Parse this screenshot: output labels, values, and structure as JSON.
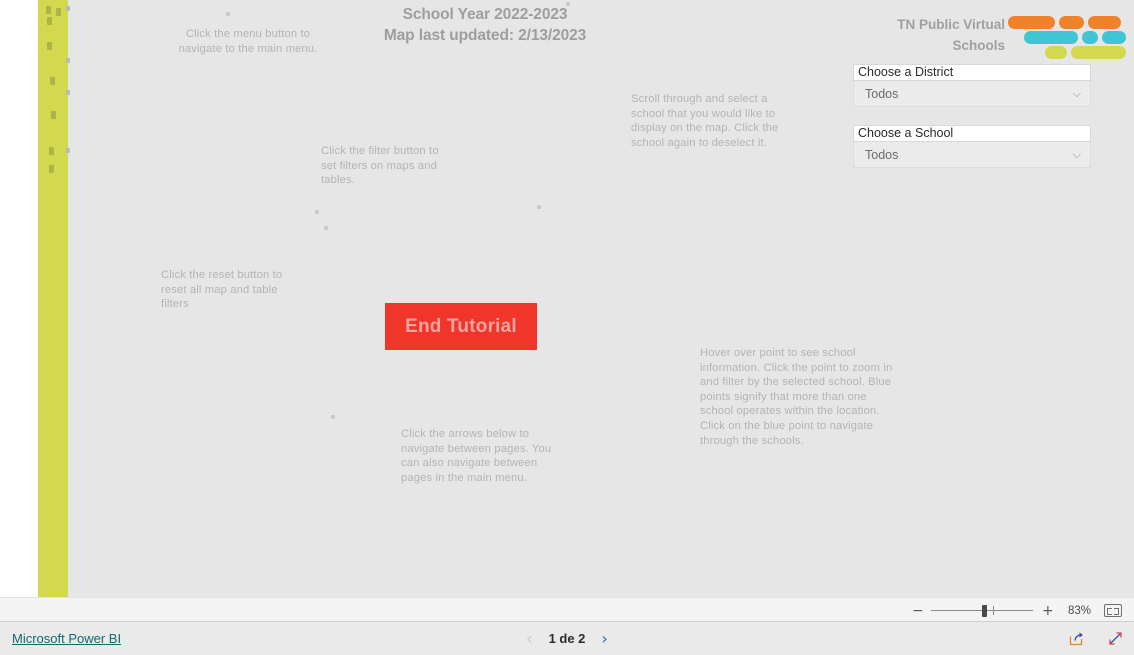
{
  "report": {
    "title_line1": "School Year 2022-2023",
    "title_line2": "Map last updated: 2/13/2023"
  },
  "brand": {
    "line1": "TN Public Virtual",
    "line2": "Schools",
    "logo_name": "tn-public-virtual-schools-logo",
    "colors": {
      "orange": "#f0832a",
      "teal": "#3fc6d4",
      "lime": "#d3d94e"
    }
  },
  "slicers": [
    {
      "header": "Choose a District",
      "value": "Todos",
      "caret": "⌵"
    },
    {
      "header": "Choose a School",
      "value": "Todos",
      "caret": "⌵"
    }
  ],
  "tutorial": {
    "annotations": [
      {
        "name": "menu-hint",
        "text": "Click the menu button to navigate to the main menu."
      },
      {
        "name": "filter-hint",
        "text": "Click the filter button to set filters on maps and tables."
      },
      {
        "name": "reset-hint",
        "text": "Click the reset button to reset all map and table filters"
      },
      {
        "name": "scroll-hint",
        "text": "Scroll through and select a school that you would like to display on the map. Click the school again to deselect it."
      },
      {
        "name": "point-hint",
        "text": "Hover over point to see school information. Click the point to zoom in and filter by the selected school. Blue points signify that more than one school operates within the location. Click on the blue point to navigate through the schools."
      },
      {
        "name": "pager-hint",
        "text": "Click the arrows below to navigate between pages. You can also navigate between pages in the main menu."
      }
    ],
    "end_button_label": "End Tutorial",
    "end_button_color": "#f0362a"
  },
  "status_bar": {
    "zoom_out_label": "−",
    "zoom_in_label": "+",
    "zoom_level": "83%",
    "fit_to_page_name": "fit-to-page-icon"
  },
  "footer": {
    "powerbi_link": "Microsoft Power BI",
    "prev_arrow": "‹",
    "next_arrow": "›",
    "page_label": "1 de 2",
    "share_icon": "share-icon",
    "fullscreen_icon": "fullscreen-icon"
  }
}
